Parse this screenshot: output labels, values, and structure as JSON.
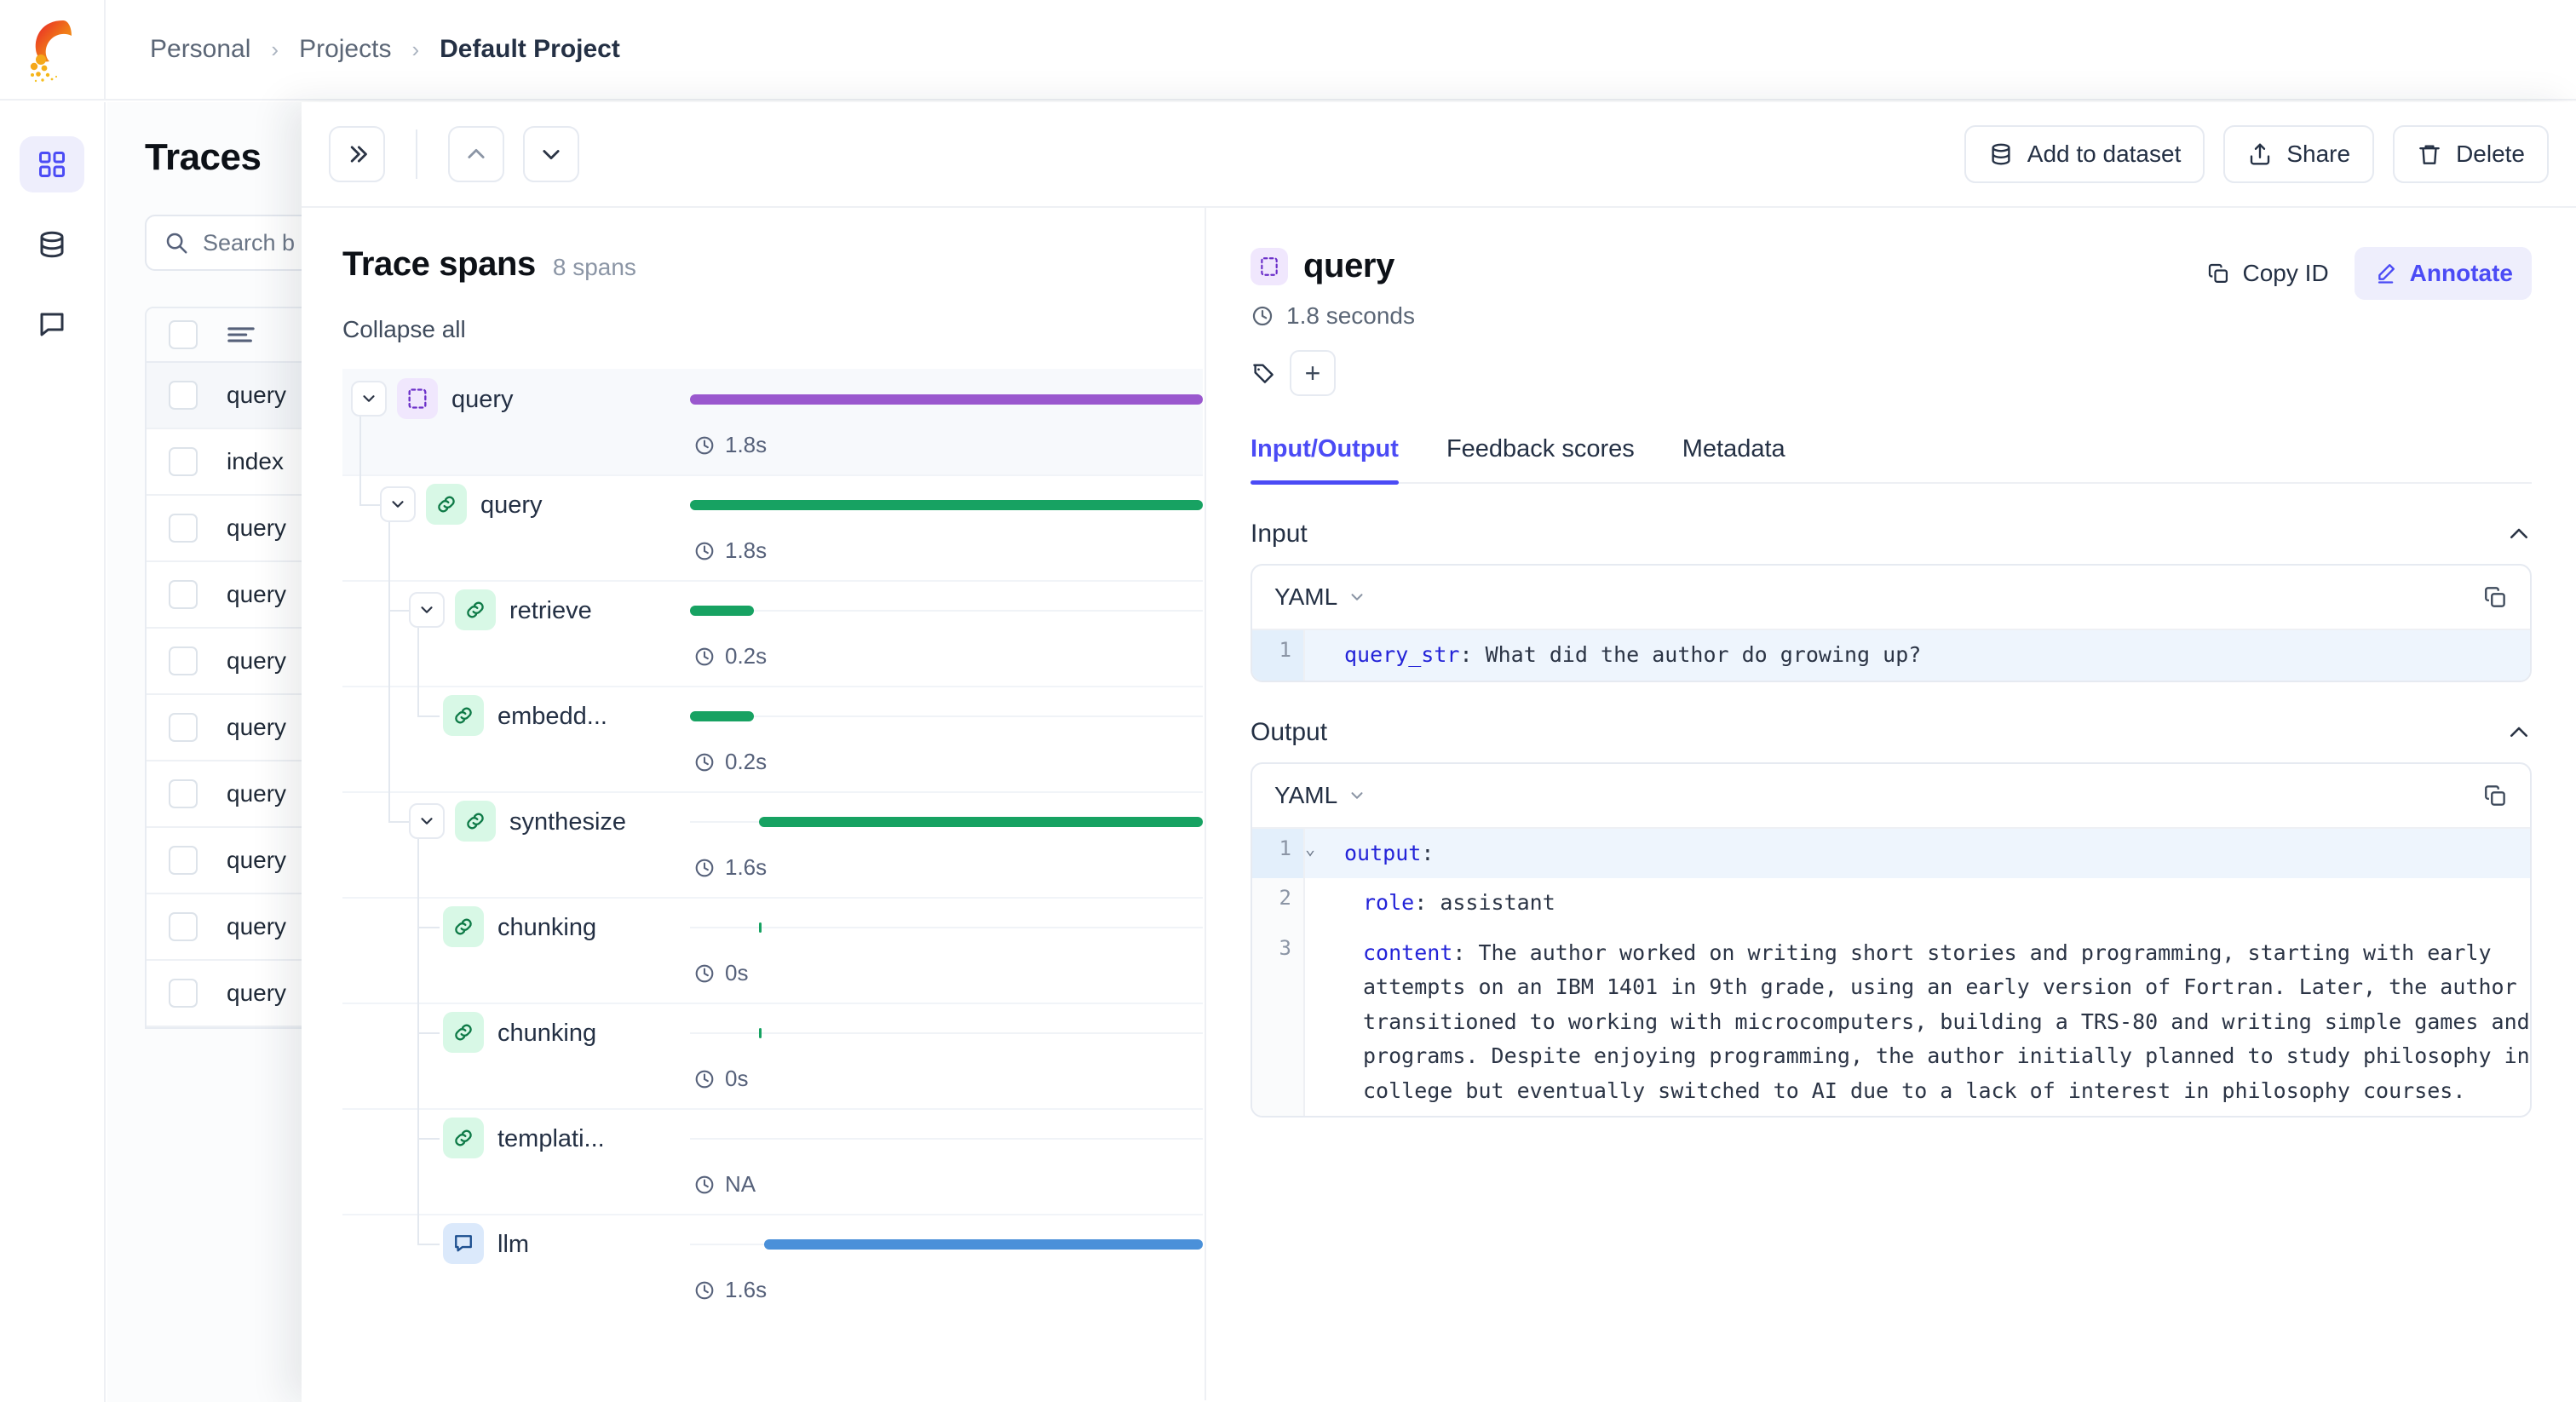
{
  "breadcrumb": {
    "items": [
      "Personal",
      "Projects",
      "Default Project"
    ]
  },
  "rail": {
    "items": [
      {
        "name": "grid-icon",
        "active": true
      },
      {
        "name": "database-icon",
        "active": false
      },
      {
        "name": "comment-icon",
        "active": false
      }
    ]
  },
  "traces_page": {
    "title": "Traces",
    "search_placeholder": "Search b",
    "rows": [
      "query",
      "index",
      "query",
      "query",
      "query",
      "query",
      "query",
      "query",
      "query",
      "query"
    ]
  },
  "toolbar": {
    "expand_label": "»",
    "prev_label": "⌃",
    "next_label": "⌄",
    "add_to_dataset": "Add to dataset",
    "share": "Share",
    "delete": "Delete"
  },
  "spans_panel": {
    "title": "Trace spans",
    "count_label": "8 spans",
    "collapse_all": "Collapse all",
    "rows": [
      {
        "name": "query",
        "duration": "1.8s",
        "icon": "trace-icon",
        "icon_color": "purple",
        "bar_color": "#9a58ce",
        "depth": 0,
        "chevron": true,
        "selected": true,
        "bar_start": 0.0,
        "bar_width": 100.0
      },
      {
        "name": "query",
        "duration": "1.8s",
        "icon": "link-icon",
        "icon_color": "green",
        "bar_color": "#17a262",
        "depth": 1,
        "chevron": true,
        "selected": false,
        "bar_start": 0.0,
        "bar_width": 100.0
      },
      {
        "name": "retrieve",
        "duration": "0.2s",
        "icon": "link-icon",
        "icon_color": "green",
        "bar_color": "#17a262",
        "depth": 2,
        "chevron": true,
        "selected": false,
        "bar_start": 0.0,
        "bar_width": 12.5
      },
      {
        "name": "embedd...",
        "duration": "0.2s",
        "icon": "link-icon",
        "icon_color": "green",
        "bar_color": "#17a262",
        "depth": 3,
        "chevron": false,
        "selected": false,
        "bar_start": 0.0,
        "bar_width": 12.5
      },
      {
        "name": "synthesize",
        "duration": "1.6s",
        "icon": "link-icon",
        "icon_color": "green",
        "bar_color": "#17a262",
        "depth": 2,
        "chevron": true,
        "selected": false,
        "bar_start": 13.5,
        "bar_width": 86.5
      },
      {
        "name": "chunking",
        "duration": "0s",
        "icon": "link-icon",
        "icon_color": "green",
        "bar_color": "#17a262",
        "depth": 3,
        "chevron": false,
        "selected": false,
        "bar_start": 13.5,
        "bar_width": 0.35
      },
      {
        "name": "chunking",
        "duration": "0s",
        "icon": "link-icon",
        "icon_color": "green",
        "bar_color": "#17a262",
        "depth": 3,
        "chevron": false,
        "selected": false,
        "bar_start": 13.5,
        "bar_width": 0.35
      },
      {
        "name": "templati...",
        "duration": "NA",
        "icon": "link-icon",
        "icon_color": "green",
        "bar_color": "#17a262",
        "depth": 3,
        "chevron": false,
        "selected": false,
        "bar_start": 0.0,
        "bar_width": 0.0
      },
      {
        "name": "llm",
        "duration": "1.6s",
        "icon": "comment-icon",
        "icon_color": "blue",
        "bar_color": "#4a90d9",
        "depth": 3,
        "chevron": false,
        "selected": false,
        "bar_start": 14.5,
        "bar_width": 85.5
      }
    ]
  },
  "details": {
    "title": "query",
    "icon": "trace-icon",
    "duration": "1.8 seconds",
    "copy_id_label": "Copy ID",
    "annotate_label": "Annotate",
    "tabs": [
      {
        "label": "Input/Output",
        "active": true
      },
      {
        "label": "Feedback scores",
        "active": false
      },
      {
        "label": "Metadata",
        "active": false
      }
    ],
    "input": {
      "section_label": "Input",
      "format": "YAML",
      "lines": [
        {
          "num": "1",
          "key": "query_str",
          "text": ": What did the author do growing up?",
          "highlight": true,
          "fold": false,
          "indent": 0
        }
      ]
    },
    "output": {
      "section_label": "Output",
      "format": "YAML",
      "lines": [
        {
          "num": "1",
          "key": "output",
          "text": ":",
          "highlight": true,
          "fold": true,
          "indent": 0
        },
        {
          "num": "2",
          "key": "role",
          "text": ": assistant",
          "highlight": false,
          "fold": false,
          "indent": 1
        },
        {
          "num": "3",
          "key": "content",
          "text": ": The author worked on writing short stories and programming, starting with early attempts on an IBM 1401 in 9th grade, using an early version of Fortran. Later, the author transitioned to working with microcomputers, building a TRS-80 and writing simple games and programs. Despite enjoying programming, the author initially planned to study philosophy in college but eventually switched to AI due to a lack of interest in philosophy courses.",
          "highlight": false,
          "fold": false,
          "indent": 1
        }
      ]
    }
  },
  "colors": {
    "accent": "#4b4bf5",
    "purple_bar": "#9a58ce",
    "green_bar": "#17a262",
    "blue_bar": "#4a90d9"
  }
}
